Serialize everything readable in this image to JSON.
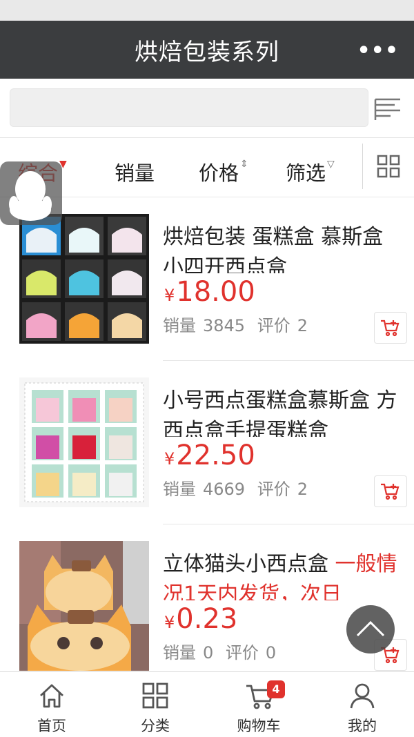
{
  "header": {
    "title": "烘焙包装系列",
    "more_label": "•••"
  },
  "search": {
    "value": "",
    "placeholder": ""
  },
  "sort": {
    "items": [
      {
        "label": "综合",
        "active": true
      },
      {
        "label": "销量"
      },
      {
        "label": "价格"
      },
      {
        "label": "筛选"
      }
    ]
  },
  "products": [
    {
      "title": "烘焙包装 蛋糕盒 慕斯盒 小四开西点盒",
      "currency": "¥",
      "price": "18.00",
      "sales_label": "销量",
      "sales": "3845",
      "review_label": "评价",
      "reviews": "2"
    },
    {
      "title": "小号西点蛋糕盒慕斯盒 方西点盒手提蛋糕盒",
      "currency": "¥",
      "price": "22.50",
      "sales_label": "销量",
      "sales": "4669",
      "review_label": "评价",
      "reviews": "2"
    },
    {
      "title": "立体猫头小西点盒",
      "promo": " 一般情况1天内发货，次日",
      "currency": "¥",
      "price": "0.23",
      "sales_label": "销量",
      "sales": "0",
      "review_label": "评价",
      "reviews": "0"
    }
  ],
  "tabbar": {
    "items": [
      {
        "label": "首页",
        "icon": "home-icon"
      },
      {
        "label": "分类",
        "icon": "category-grid-icon"
      },
      {
        "label": "购物车",
        "icon": "shopping-cart-icon",
        "badge": "4"
      },
      {
        "label": "我的",
        "icon": "user-icon"
      }
    ]
  },
  "colors": {
    "accent": "#e0322d",
    "header_bg": "#3b3d3f"
  }
}
